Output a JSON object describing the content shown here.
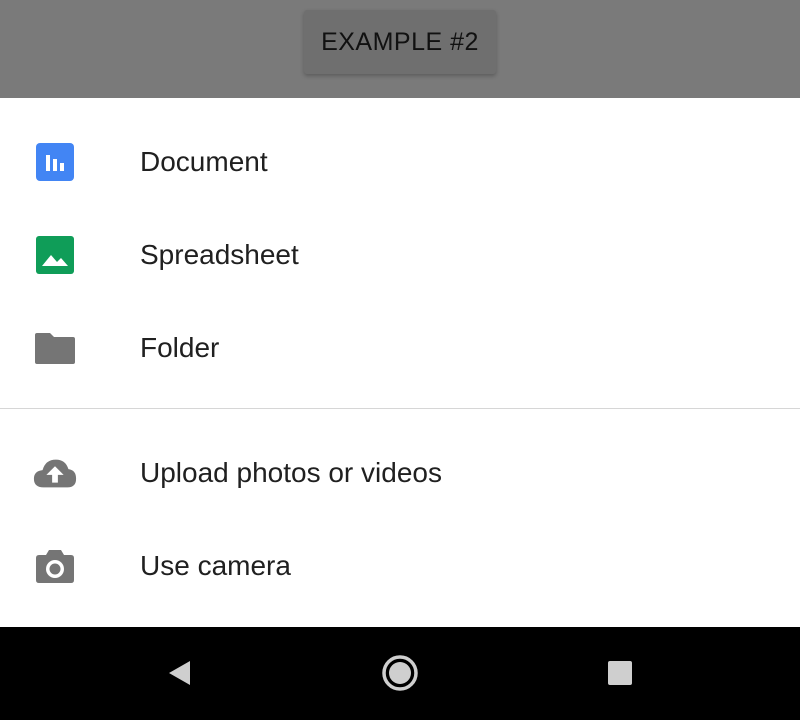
{
  "header": {
    "example_label": "EXAMPLE #2"
  },
  "colors": {
    "document_icon": "#4285F4",
    "spreadsheet_icon": "#0F9D58",
    "neutral_icon": "#757575",
    "scrim": "#7A7A7A",
    "navbar": "#000000"
  },
  "sheet": {
    "create_items": [
      {
        "label": "Document",
        "icon": "document-icon"
      },
      {
        "label": "Spreadsheet",
        "icon": "spreadsheet-icon"
      },
      {
        "label": "Folder",
        "icon": "folder-icon"
      }
    ],
    "upload_items": [
      {
        "label": "Upload photos or videos",
        "icon": "cloud-upload-icon"
      },
      {
        "label": "Use camera",
        "icon": "camera-icon"
      }
    ]
  },
  "navbar": {
    "buttons": [
      "back-icon",
      "home-icon",
      "recents-icon"
    ]
  }
}
